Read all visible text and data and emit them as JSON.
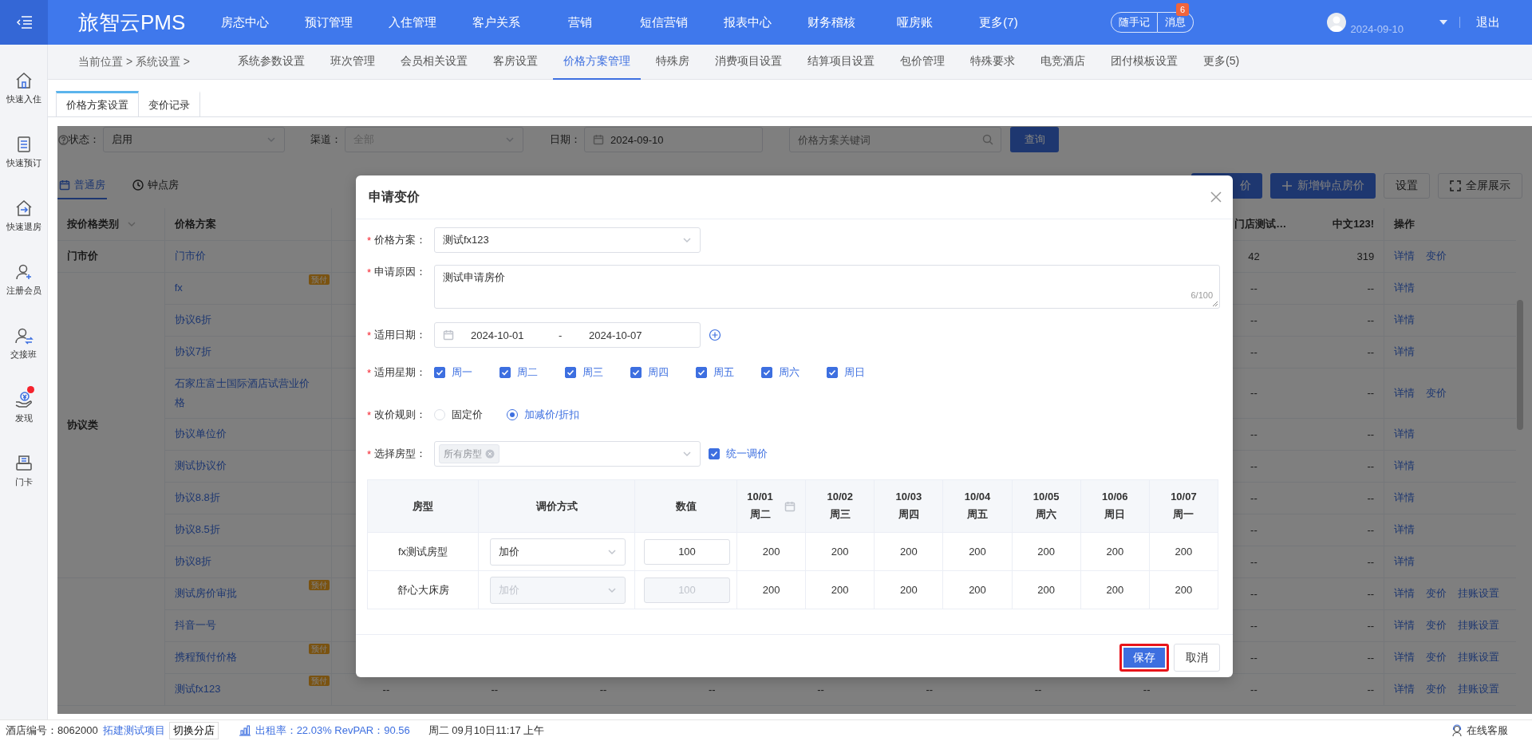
{
  "header": {
    "logo": "旅智云PMS",
    "menu": [
      "房态中心",
      "预订管理",
      "入住管理",
      "客户关系",
      "营销",
      "短信营销",
      "报表中心",
      "财务稽核",
      "哑房账",
      "更多(7)"
    ],
    "notes_button": "随手记",
    "messages_button": "消息",
    "messages_badge": "6",
    "user_date": "2024-09-10",
    "logout": "退出"
  },
  "sidebar": {
    "items": [
      {
        "label": "快速入住",
        "dot": false
      },
      {
        "label": "快速预订",
        "dot": false
      },
      {
        "label": "快速退房",
        "dot": false
      },
      {
        "label": "注册会员",
        "dot": false
      },
      {
        "label": "交接班",
        "dot": false
      },
      {
        "label": "发现",
        "dot": true
      },
      {
        "label": "门卡",
        "dot": false
      }
    ]
  },
  "breadcrumb": "当前位置 > 系统设置 >",
  "settings_tabs": [
    {
      "label": "系统参数设置",
      "selected": false
    },
    {
      "label": "班次管理",
      "selected": false
    },
    {
      "label": "会员相关设置",
      "selected": false
    },
    {
      "label": "客房设置",
      "selected": false
    },
    {
      "label": "价格方案管理",
      "selected": true
    },
    {
      "label": "特殊房",
      "selected": false
    },
    {
      "label": "消费项目设置",
      "selected": false
    },
    {
      "label": "结算项目设置",
      "selected": false
    },
    {
      "label": "包价管理",
      "selected": false
    },
    {
      "label": "特殊要求",
      "selected": false
    },
    {
      "label": "电竞酒店",
      "selected": false
    },
    {
      "label": "团付模板设置",
      "selected": false
    },
    {
      "label": "更多(5)",
      "selected": false
    }
  ],
  "page_tabs": [
    {
      "label": "价格方案设置",
      "selected": true
    },
    {
      "label": "变价记录",
      "selected": false
    }
  ],
  "filters": {
    "status_label": "状态：",
    "status_value": "启用",
    "channel_label": "渠道：",
    "channel_value": "全部",
    "date_label": "日期：",
    "date_value": "2024-09-10",
    "search_placeholder": "价格方案关键词",
    "query_button": "查询"
  },
  "room_tabs": [
    {
      "label": "普通房",
      "selected": true
    },
    {
      "label": "钟点房",
      "selected": false
    }
  ],
  "toolbar_buttons": [
    {
      "label": "价",
      "kind": "primary"
    },
    {
      "label": "新增钟点房价",
      "kind": "add"
    },
    {
      "label": "设置",
      "kind": "plain"
    },
    {
      "label": "全屏展示",
      "kind": "fullscreen"
    }
  ],
  "price_table": {
    "columns": [
      "按价格类别",
      "价格方案",
      "门店测试…",
      "中文123!",
      "操作"
    ],
    "groups": [
      {
        "category": "门市价",
        "rows": [
          {
            "plan": "门市价",
            "values": [
              "42",
              "319"
            ],
            "actions": [
              "详情",
              "变价"
            ]
          }
        ]
      },
      {
        "category": "协议类",
        "rows": [
          {
            "plan": "fx",
            "tag": "预付",
            "values": [
              "--",
              "--"
            ],
            "actions": [
              "详情"
            ]
          },
          {
            "plan": "协议6折",
            "values": [
              "--",
              "--"
            ],
            "actions": [
              "详情"
            ]
          },
          {
            "plan": "协议7折",
            "values": [
              "--",
              "--"
            ],
            "actions": [
              "详情"
            ]
          },
          {
            "plan": "石家庄富士国际酒店试营业价格",
            "values": [
              "--",
              "--"
            ],
            "actions": [
              "详情",
              "变价"
            ]
          },
          {
            "plan": "协议单位价",
            "values": [
              "--",
              "--"
            ],
            "actions": [
              "详情"
            ]
          },
          {
            "plan": "测试协议价",
            "values": [
              "--",
              "--"
            ],
            "actions": [
              "详情"
            ]
          },
          {
            "plan": "协议8.8折",
            "values": [
              "--",
              "--"
            ],
            "actions": [
              "详情"
            ]
          },
          {
            "plan": "协议8.5折",
            "values": [
              "--",
              "--"
            ],
            "actions": [
              "详情"
            ]
          },
          {
            "plan": "协议8折",
            "values": [
              "--",
              "--"
            ],
            "actions": [
              "详情"
            ]
          }
        ]
      },
      {
        "rows": [
          {
            "plan": "测试房价审批",
            "tag": "预付",
            "values": [
              "--",
              "--"
            ],
            "actions": [
              "详情",
              "变价",
              "挂账设置"
            ]
          },
          {
            "plan": "抖音一号",
            "values": [
              "--",
              "--"
            ],
            "actions": [
              "详情",
              "变价",
              "挂账设置"
            ]
          },
          {
            "plan": "携程预付价格",
            "tag": "预付",
            "values": [
              "--",
              "--"
            ],
            "actions": [
              "详情",
              "变价",
              "挂账设置"
            ]
          },
          {
            "plan": "测试fx123",
            "tag": "预付",
            "cells": [
              "--",
              "--",
              "--",
              "--",
              "--",
              "--",
              "--",
              "--"
            ],
            "values": [
              "--",
              "--"
            ],
            "actions": [
              "详情",
              "变价",
              "挂账设置"
            ]
          }
        ]
      }
    ]
  },
  "modal": {
    "title": "申请变价",
    "plan": {
      "mark": "*",
      "label": "价格方案：",
      "value": "测试fx123"
    },
    "reason": {
      "mark": "*",
      "label": "申请原因：",
      "value": "测试申请房价",
      "counter": "6/100"
    },
    "dates": {
      "mark": "*",
      "label": "适用日期：",
      "start": "2024-10-01",
      "separator": "-",
      "end": "2024-10-07"
    },
    "weekdays": {
      "mark": "*",
      "label": "适用星期：",
      "options": [
        {
          "label": "周一",
          "checked": true
        },
        {
          "label": "周二",
          "checked": true
        },
        {
          "label": "周三",
          "checked": true
        },
        {
          "label": "周四",
          "checked": true
        },
        {
          "label": "周五",
          "checked": true
        },
        {
          "label": "周六",
          "checked": true
        },
        {
          "label": "周日",
          "checked": true
        }
      ]
    },
    "rule": {
      "mark": "*",
      "label": "改价规则：",
      "options": [
        {
          "label": "固定价",
          "selected": false
        },
        {
          "label": "加减价/折扣",
          "selected": true
        }
      ]
    },
    "room_types": {
      "mark": "*",
      "label": "选择房型：",
      "tags": [
        "所有房型"
      ],
      "unified": {
        "label": "统一调价",
        "checked": true
      }
    },
    "table": {
      "columns": [
        "房型",
        "调价方式",
        "数值"
      ],
      "dates": [
        {
          "date": "10/01",
          "weekday": "周二",
          "calendar": true
        },
        {
          "date": "10/02",
          "weekday": "周三",
          "calendar": false
        },
        {
          "date": "10/03",
          "weekday": "周四",
          "calendar": false
        },
        {
          "date": "10/04",
          "weekday": "周五",
          "calendar": false
        },
        {
          "date": "10/05",
          "weekday": "周六",
          "calendar": false
        },
        {
          "date": "10/06",
          "weekday": "周日",
          "calendar": false
        },
        {
          "date": "10/07",
          "weekday": "周一",
          "calendar": false
        }
      ],
      "rows": [
        {
          "room": "fx测试房型",
          "method": "加价",
          "value": "100",
          "disabled": false,
          "prices": [
            "200",
            "200",
            "200",
            "200",
            "200",
            "200",
            "200"
          ]
        },
        {
          "room": "舒心大床房",
          "method": "加价",
          "value": "100",
          "disabled": true,
          "prices": [
            "200",
            "200",
            "200",
            "200",
            "200",
            "200",
            "200"
          ]
        }
      ]
    },
    "buttons": [
      {
        "label": "保存",
        "kind": "primary",
        "highlighted": true
      },
      {
        "label": "取消",
        "kind": "plain",
        "highlighted": false
      }
    ]
  },
  "status_bar": {
    "hotel": "酒店编号：8062000",
    "project_link": "拓建测试项目",
    "switch_button": "切换分店",
    "occupancy": "出租率：22.03% RevPAR：90.56",
    "datetime": "周二 09月10日11:17 上午",
    "support": "在线客服"
  }
}
